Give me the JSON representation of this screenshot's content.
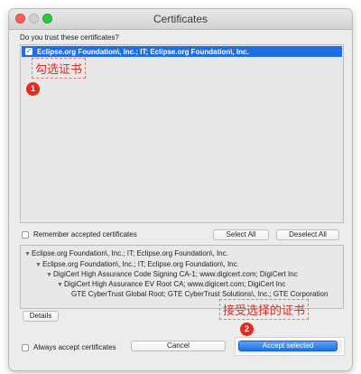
{
  "window": {
    "title": "Certificates"
  },
  "question": "Do you trust these certificates?",
  "cert_list": {
    "items": [
      {
        "label": "Eclipse.org Foundation\\, Inc.; IT; Eclipse.org Foundation\\, Inc.",
        "checked": true,
        "check_glyph": "✓"
      }
    ]
  },
  "annotations": {
    "step1_text": "勾选证书",
    "step1_badge": "1",
    "step2_text": "接受选择的证书",
    "step2_badge": "2"
  },
  "remember": {
    "label": "Remember accepted certificates",
    "checked": false
  },
  "buttons": {
    "select_all": "Select All",
    "deselect_all": "Deselect All",
    "details": "Details",
    "cancel": "Cancel",
    "accept_selected": "Accept selected"
  },
  "tree": {
    "lines": [
      "Eclipse.org Foundation\\, Inc.; IT; Eclipse.org Foundation\\, Inc.",
      "Eclipse.org Foundation\\, Inc.; IT; Eclipse.org Foundation\\, Inc.",
      "DigiCert High Assurance Code Signing CA-1; www.digicert.com; DigiCert Inc",
      "DigiCert High Assurance EV Root CA; www.digicert.com; DigiCert Inc",
      "GTE CyberTrust Global Root; GTE CyberTrust Solutions\\, Inc.; GTE Corporation"
    ],
    "expander_glyph": "▼"
  },
  "always_accept": {
    "label": "Always accept certificates",
    "checked": false
  },
  "colors": {
    "accent": "#1f6fe0",
    "annotation_red": "#d0302a",
    "badge_red": "#e8291c"
  }
}
